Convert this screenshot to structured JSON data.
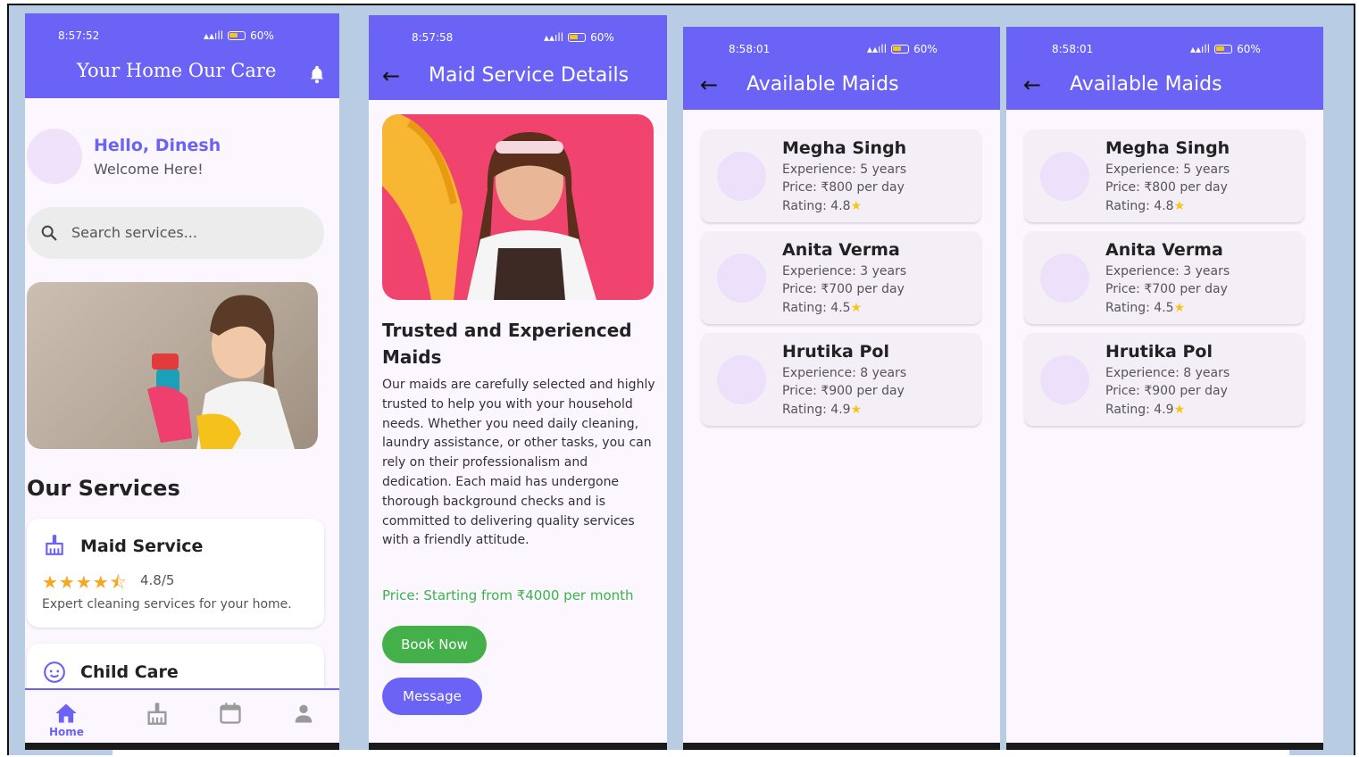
{
  "screens": {
    "home": {
      "status": {
        "time": "8:57:52",
        "battery": "60%"
      },
      "app_title": "Your Home Our Care",
      "greeting": "Hello, Dinesh",
      "welcome": "Welcome Here!",
      "search_placeholder": "Search services...",
      "section_title": "Our Services",
      "services": [
        {
          "name": "Maid Service",
          "stars": "★★★★⯪",
          "rating": "4.8/5",
          "description": "Expert cleaning services for your home.",
          "icon": "broom-icon"
        },
        {
          "name": "Child Care",
          "icon": "baby-face-icon"
        }
      ],
      "bottom_nav": {
        "items": [
          "home-icon",
          "broom-icon",
          "calendar-icon",
          "person-icon"
        ],
        "active_label": "Home"
      }
    },
    "details": {
      "status": {
        "time": "8:57:58",
        "battery": "60%"
      },
      "title": "Maid Service Details",
      "heading": "Trusted and Experienced Maids",
      "description": "Our maids are carefully selected and highly trusted to help you with your household needs. Whether you need daily cleaning, laundry assistance, or other tasks, you can rely on their professionalism and dedication. Each maid has undergone thorough background checks and is committed to delivering quality services with a friendly attitude.",
      "price": "Price: Starting from ₹4000 per month",
      "book_label": "Book Now",
      "message_label": "Message"
    },
    "available_a": {
      "status": {
        "time": "8:58:01",
        "battery": "60%"
      },
      "title": "Available Maids"
    },
    "available_b": {
      "status": {
        "time": "8:58:01",
        "battery": "60%"
      },
      "title": "Available Maids"
    }
  },
  "maids": [
    {
      "name": "Megha Singh",
      "experience": "Experience: 5 years",
      "price": "Price: ₹800 per day",
      "rating": "Rating: 4.8"
    },
    {
      "name": "Anita Verma",
      "experience": "Experience: 3 years",
      "price": "Price: ₹700 per day",
      "rating": "Rating: 4.5"
    },
    {
      "name": "Hrutika Pol",
      "experience": "Experience: 8 years",
      "price": "Price: ₹900 per day",
      "rating": "Rating: 4.9"
    }
  ],
  "colors": {
    "primary": "#6b63f6",
    "success": "#43b04a",
    "background": "#fcf6ff",
    "frame": "#b8cce4"
  }
}
